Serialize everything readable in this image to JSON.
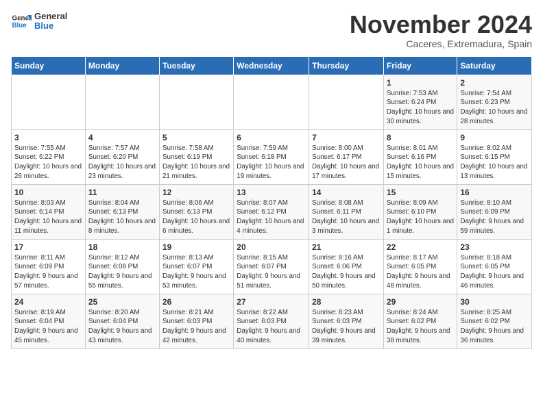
{
  "logo": {
    "line1": "General",
    "line2": "Blue"
  },
  "title": "November 2024",
  "subtitle": "Caceres, Extremadura, Spain",
  "headers": [
    "Sunday",
    "Monday",
    "Tuesday",
    "Wednesday",
    "Thursday",
    "Friday",
    "Saturday"
  ],
  "weeks": [
    [
      {
        "day": "",
        "info": ""
      },
      {
        "day": "",
        "info": ""
      },
      {
        "day": "",
        "info": ""
      },
      {
        "day": "",
        "info": ""
      },
      {
        "day": "",
        "info": ""
      },
      {
        "day": "1",
        "info": "Sunrise: 7:53 AM\nSunset: 6:24 PM\nDaylight: 10 hours and 30 minutes."
      },
      {
        "day": "2",
        "info": "Sunrise: 7:54 AM\nSunset: 6:23 PM\nDaylight: 10 hours and 28 minutes."
      }
    ],
    [
      {
        "day": "3",
        "info": "Sunrise: 7:55 AM\nSunset: 6:22 PM\nDaylight: 10 hours and 26 minutes."
      },
      {
        "day": "4",
        "info": "Sunrise: 7:57 AM\nSunset: 6:20 PM\nDaylight: 10 hours and 23 minutes."
      },
      {
        "day": "5",
        "info": "Sunrise: 7:58 AM\nSunset: 6:19 PM\nDaylight: 10 hours and 21 minutes."
      },
      {
        "day": "6",
        "info": "Sunrise: 7:59 AM\nSunset: 6:18 PM\nDaylight: 10 hours and 19 minutes."
      },
      {
        "day": "7",
        "info": "Sunrise: 8:00 AM\nSunset: 6:17 PM\nDaylight: 10 hours and 17 minutes."
      },
      {
        "day": "8",
        "info": "Sunrise: 8:01 AM\nSunset: 6:16 PM\nDaylight: 10 hours and 15 minutes."
      },
      {
        "day": "9",
        "info": "Sunrise: 8:02 AM\nSunset: 6:15 PM\nDaylight: 10 hours and 13 minutes."
      }
    ],
    [
      {
        "day": "10",
        "info": "Sunrise: 8:03 AM\nSunset: 6:14 PM\nDaylight: 10 hours and 11 minutes."
      },
      {
        "day": "11",
        "info": "Sunrise: 8:04 AM\nSunset: 6:13 PM\nDaylight: 10 hours and 8 minutes."
      },
      {
        "day": "12",
        "info": "Sunrise: 8:06 AM\nSunset: 6:13 PM\nDaylight: 10 hours and 6 minutes."
      },
      {
        "day": "13",
        "info": "Sunrise: 8:07 AM\nSunset: 6:12 PM\nDaylight: 10 hours and 4 minutes."
      },
      {
        "day": "14",
        "info": "Sunrise: 8:08 AM\nSunset: 6:11 PM\nDaylight: 10 hours and 3 minutes."
      },
      {
        "day": "15",
        "info": "Sunrise: 8:09 AM\nSunset: 6:10 PM\nDaylight: 10 hours and 1 minute."
      },
      {
        "day": "16",
        "info": "Sunrise: 8:10 AM\nSunset: 6:09 PM\nDaylight: 9 hours and 59 minutes."
      }
    ],
    [
      {
        "day": "17",
        "info": "Sunrise: 8:11 AM\nSunset: 6:09 PM\nDaylight: 9 hours and 57 minutes."
      },
      {
        "day": "18",
        "info": "Sunrise: 8:12 AM\nSunset: 6:08 PM\nDaylight: 9 hours and 55 minutes."
      },
      {
        "day": "19",
        "info": "Sunrise: 8:13 AM\nSunset: 6:07 PM\nDaylight: 9 hours and 53 minutes."
      },
      {
        "day": "20",
        "info": "Sunrise: 8:15 AM\nSunset: 6:07 PM\nDaylight: 9 hours and 51 minutes."
      },
      {
        "day": "21",
        "info": "Sunrise: 8:16 AM\nSunset: 6:06 PM\nDaylight: 9 hours and 50 minutes."
      },
      {
        "day": "22",
        "info": "Sunrise: 8:17 AM\nSunset: 6:05 PM\nDaylight: 9 hours and 48 minutes."
      },
      {
        "day": "23",
        "info": "Sunrise: 8:18 AM\nSunset: 6:05 PM\nDaylight: 9 hours and 46 minutes."
      }
    ],
    [
      {
        "day": "24",
        "info": "Sunrise: 8:19 AM\nSunset: 6:04 PM\nDaylight: 9 hours and 45 minutes."
      },
      {
        "day": "25",
        "info": "Sunrise: 8:20 AM\nSunset: 6:04 PM\nDaylight: 9 hours and 43 minutes."
      },
      {
        "day": "26",
        "info": "Sunrise: 8:21 AM\nSunset: 6:03 PM\nDaylight: 9 hours and 42 minutes."
      },
      {
        "day": "27",
        "info": "Sunrise: 8:22 AM\nSunset: 6:03 PM\nDaylight: 9 hours and 40 minutes."
      },
      {
        "day": "28",
        "info": "Sunrise: 8:23 AM\nSunset: 6:03 PM\nDaylight: 9 hours and 39 minutes."
      },
      {
        "day": "29",
        "info": "Sunrise: 8:24 AM\nSunset: 6:02 PM\nDaylight: 9 hours and 38 minutes."
      },
      {
        "day": "30",
        "info": "Sunrise: 8:25 AM\nSunset: 6:02 PM\nDaylight: 9 hours and 36 minutes."
      }
    ]
  ]
}
